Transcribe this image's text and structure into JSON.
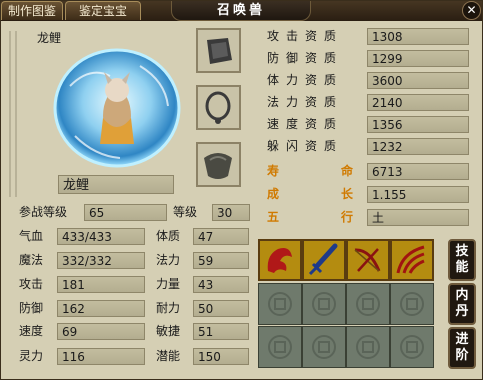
{
  "tabs": [
    "制作图鉴",
    "鉴定宝宝"
  ],
  "title": "召唤兽",
  "close_icon": "close-icon",
  "pet": {
    "name_top": "龙鲤",
    "name": "龙鲤"
  },
  "equip_slots": [
    "armor-icon",
    "collar-icon",
    "amulet-icon"
  ],
  "aptitudes": [
    {
      "label": "攻击资质",
      "value": "1308"
    },
    {
      "label": "防御资质",
      "value": "1299"
    },
    {
      "label": "体力资质",
      "value": "3600"
    },
    {
      "label": "法力资质",
      "value": "2140"
    },
    {
      "label": "速度资质",
      "value": "1356"
    },
    {
      "label": "躲闪资质",
      "value": "1232"
    }
  ],
  "special": [
    {
      "label": "寿命",
      "value": "6713"
    },
    {
      "label": "成长",
      "value": "1.155"
    },
    {
      "label": "五行",
      "value": "土"
    }
  ],
  "battle_level": {
    "label": "参战等级",
    "value": "65"
  },
  "level": {
    "label": "等级",
    "value": "30"
  },
  "stats_left": [
    {
      "label": "气血",
      "value": "433/433"
    },
    {
      "label": "魔法",
      "value": "332/332"
    },
    {
      "label": "攻击",
      "value": "181"
    },
    {
      "label": "防御",
      "value": "162"
    },
    {
      "label": "速度",
      "value": "69"
    },
    {
      "label": "灵力",
      "value": "116"
    }
  ],
  "stats_right": [
    {
      "label": "体质",
      "value": "47"
    },
    {
      "label": "法力",
      "value": "59"
    },
    {
      "label": "力量",
      "value": "43"
    },
    {
      "label": "耐力",
      "value": "50"
    },
    {
      "label": "敏捷",
      "value": "51"
    },
    {
      "label": "潜能",
      "value": "150"
    }
  ],
  "skills": [
    "dragon-skill-icon",
    "sword-skill-icon",
    "bow-skill-icon",
    "slash-skill-icon"
  ],
  "empty_skill_slots": 8,
  "side_buttons": [
    {
      "label": "技能",
      "chars": [
        "技",
        "能"
      ]
    },
    {
      "label": "内丹",
      "chars": [
        "内",
        "丹"
      ]
    },
    {
      "label": "进阶",
      "chars": [
        "进",
        "阶"
      ]
    }
  ],
  "colors": {
    "special_label": "#d07a00",
    "skill_slot": "#b48c10",
    "empty_slot": "#6f7a6c"
  }
}
